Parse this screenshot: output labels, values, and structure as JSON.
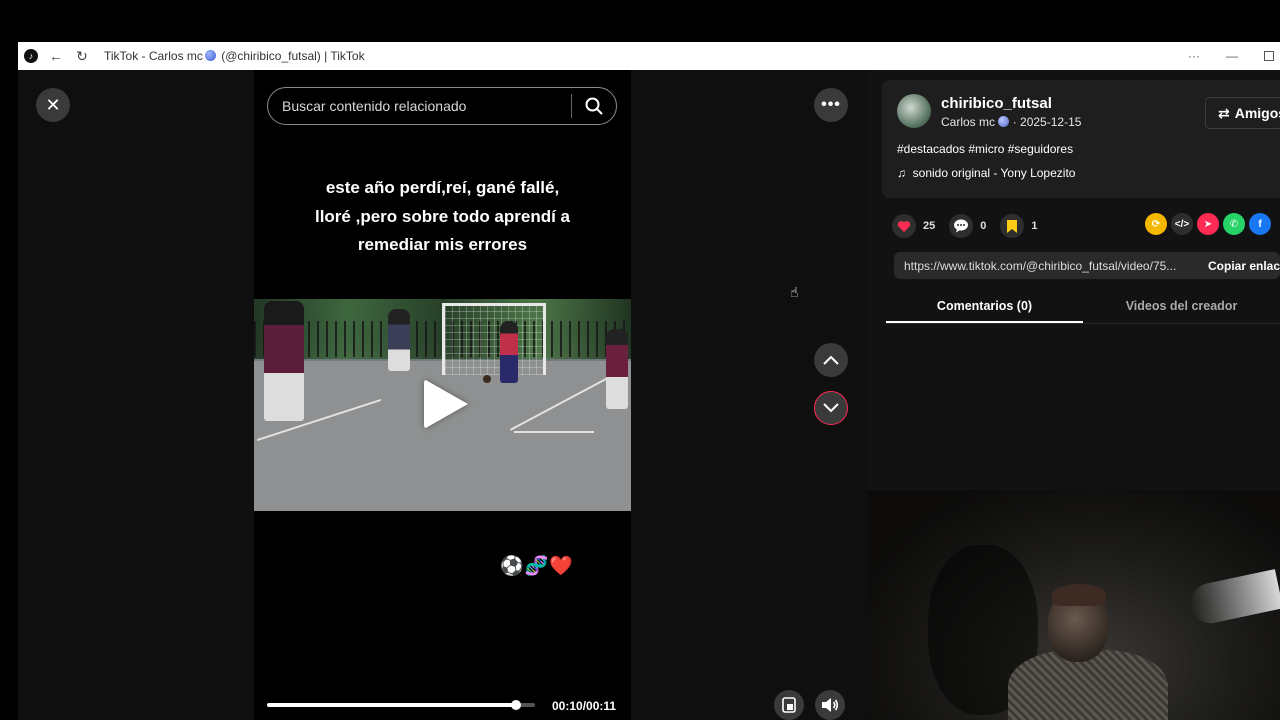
{
  "browser": {
    "title": "TikTok - Carlos mc",
    "title_suffix": "(@chiribico_futsal) | TikTok",
    "more_label": "···"
  },
  "player": {
    "search_placeholder": "Buscar contenido relacionado",
    "caption_lines": [
      "este año perdí,reí, gané fallé,",
      "lloré ,pero sobre todo aprendí a",
      "remediar mis errores"
    ],
    "emojis": "⚽🧬❤️",
    "progress_fraction": 0.93,
    "time": "00:10/00:11"
  },
  "post": {
    "username": "chiribico_futsal",
    "display_name": "Carlos mc",
    "date": "· 2025-12-15",
    "friends_label": "Amigos",
    "hashtags": "#destacados #micro #seguidores",
    "sound": "sonido original - Yony Lopezito",
    "likes": "25",
    "comments": "0",
    "saves": "1",
    "url": "https://www.tiktok.com/@chiribico_futsal/video/75...",
    "copy_label": "Copiar enlace"
  },
  "tabs": {
    "comments": "Comentarios (0)",
    "creator_videos": "Videos del creador"
  },
  "colors": {
    "accent": "#fe2c55",
    "like": "#fe2c55",
    "save": "#facc15"
  }
}
